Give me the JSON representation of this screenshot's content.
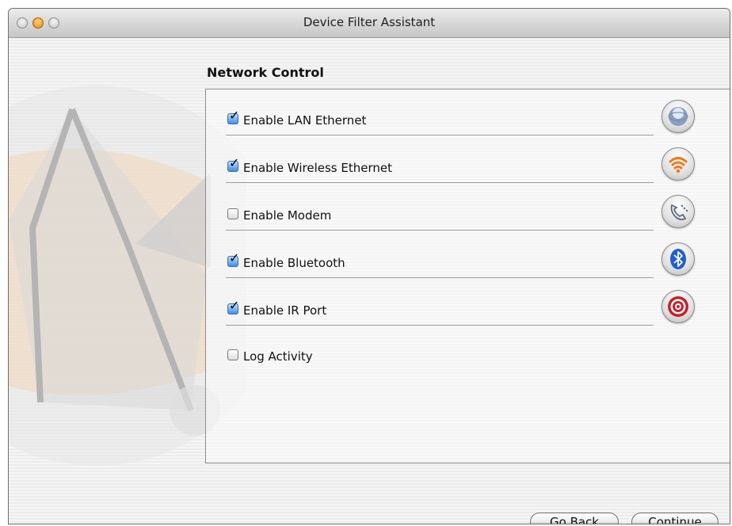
{
  "window": {
    "title": "Device Filter Assistant"
  },
  "section": {
    "title": "Network Control"
  },
  "options": [
    {
      "label": "Enable LAN Ethernet",
      "checked": true,
      "icon": "ethernet-globe-icon"
    },
    {
      "label": "Enable Wireless Ethernet",
      "checked": true,
      "icon": "wireless-icon"
    },
    {
      "label": "Enable Modem",
      "checked": false,
      "icon": "modem-phone-icon"
    },
    {
      "label": "Enable Bluetooth",
      "checked": true,
      "icon": "bluetooth-icon"
    },
    {
      "label": "Enable IR Port",
      "checked": true,
      "icon": "infrared-target-icon"
    },
    {
      "label": "Log Activity",
      "checked": false
    }
  ],
  "buttons": {
    "back": "Go Back",
    "continue": "Continue"
  },
  "colors": {
    "checkbox_checked": "#3f8fe6",
    "wireless_orange": "#f07a1a",
    "ir_red": "#c8202a",
    "bluetooth_blue": "#1f5fd0"
  }
}
